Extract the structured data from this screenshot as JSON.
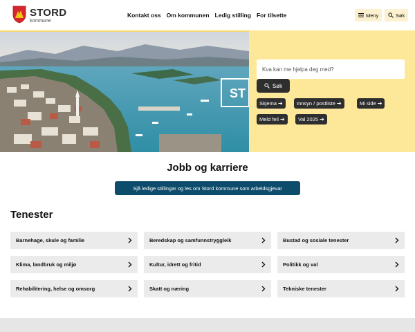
{
  "header": {
    "logo_title": "STORD",
    "logo_subtitle": "kommune",
    "nav": [
      "Kontakt oss",
      "Om kommunen",
      "Ledig stilling",
      "For tilsette"
    ],
    "menu_label": "Meny",
    "search_label": "Søk"
  },
  "hero": {
    "search_placeholder": "Kva kan me hjelpa deg med?",
    "search_button": "Søk",
    "quick_links": [
      "Skjema",
      "Innsyn / postliste",
      "Mi side",
      "Meld feil",
      "Val 2025"
    ],
    "sign_text": "ST"
  },
  "jobb": {
    "title": "Jobb og karriere",
    "button": "Sjå ledige stillingar og les om Stord kommune som arbeidsgjevar"
  },
  "tenester": {
    "title": "Tenester",
    "items": [
      "Barnehage, skule og familie",
      "Beredskap og samfunnstryggleik",
      "Bustad og sosiale tenester",
      "Klima, landbruk og miljø",
      "Kultur, idrett og fritid",
      "Politikk og val",
      "Rehabilitering, helse og omsorg",
      "Skatt og næring",
      "Tekniske tenester"
    ]
  },
  "colors": {
    "accent_yellow": "#fde89a",
    "dark_button": "#2e2e2e",
    "jobb_button": "#0d4c6b",
    "card_bg": "#ebebeb"
  }
}
